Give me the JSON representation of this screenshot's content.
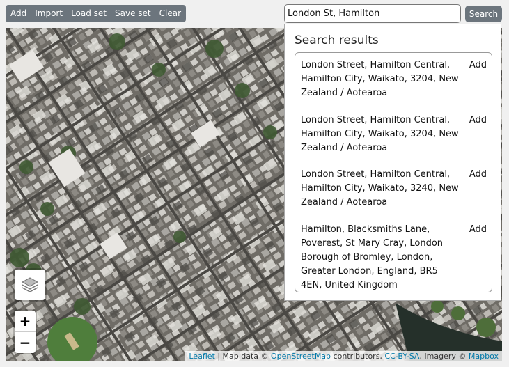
{
  "toolbar": {
    "add": "Add",
    "import": "Import",
    "load_set": "Load set",
    "save_set": "Save set",
    "clear": "Clear"
  },
  "search": {
    "value": "London St, Hamilton",
    "button": "Search"
  },
  "results": {
    "title": "Search results",
    "add_label": "Add",
    "items": [
      {
        "text": "London Street, Hamilton Central, Hamilton City, Waikato, 3204, New Zealand / Aotearoa"
      },
      {
        "text": "London Street, Hamilton Central, Hamilton City, Waikato, 3204, New Zealand / Aotearoa"
      },
      {
        "text": "London Street, Hamilton Central, Hamilton City, Waikato, 3240, New Zealand / Aotearoa"
      },
      {
        "text": "Hamilton, Blacksmiths Lane, Poverest, St Mary Cray, London Borough of Bromley, London, Greater London, England, BR5 4EN, United Kingdom"
      }
    ]
  },
  "map": {
    "zoom_in": "+",
    "zoom_out": "−",
    "layers_icon": "layers-icon",
    "attribution": {
      "leaflet": "Leaflet",
      "sep1": " | Map data © ",
      "osm": "OpenStreetMap",
      "sep2": " contributors, ",
      "license": "CC-BY-SA",
      "sep3": ", Imagery © ",
      "mapbox": "Mapbox"
    }
  },
  "colors": {
    "button_bg": "#6c757d",
    "link": "#0078a8"
  }
}
